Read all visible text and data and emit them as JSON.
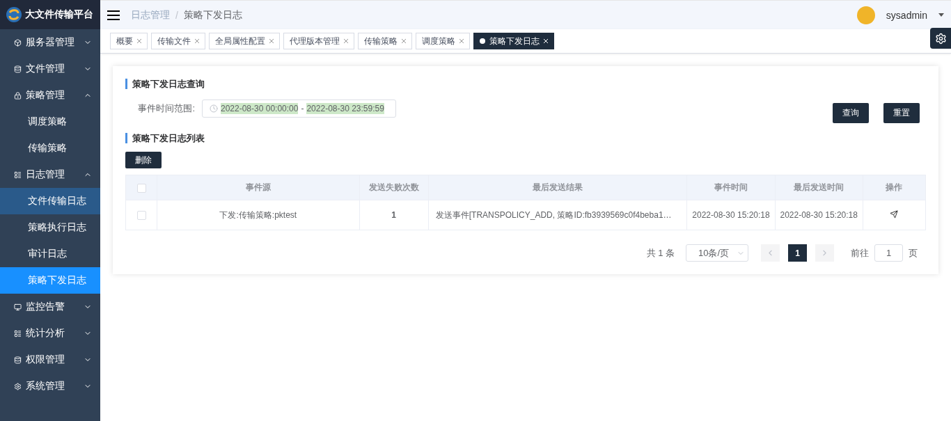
{
  "brand": {
    "title": "大文件传输平台"
  },
  "sidebar": {
    "items": [
      {
        "label": "服务器管理",
        "expanded": false
      },
      {
        "label": "文件管理",
        "expanded": false
      },
      {
        "label": "策略管理",
        "expanded": true,
        "children": [
          {
            "label": "调度策略",
            "selected": false,
            "hovered": false
          },
          {
            "label": "传输策略",
            "selected": false,
            "hovered": false
          }
        ]
      },
      {
        "label": "日志管理",
        "expanded": true,
        "children": [
          {
            "label": "文件传输日志",
            "selected": false,
            "hovered": true
          },
          {
            "label": "策略执行日志",
            "selected": false,
            "hovered": false
          },
          {
            "label": "审计日志",
            "selected": false,
            "hovered": false
          },
          {
            "label": "策略下发日志",
            "selected": true,
            "hovered": false
          }
        ]
      },
      {
        "label": "监控告警",
        "expanded": false
      },
      {
        "label": "统计分析",
        "expanded": false
      },
      {
        "label": "权限管理",
        "expanded": false
      },
      {
        "label": "系统管理",
        "expanded": false
      }
    ]
  },
  "breadcrumb": {
    "items": [
      "日志管理",
      "策略下发日志"
    ],
    "separator": "/"
  },
  "user": {
    "name": "sysadmin"
  },
  "tabs": [
    {
      "label": "概要",
      "selected": false
    },
    {
      "label": "传输文件",
      "selected": false
    },
    {
      "label": "全局属性配置",
      "selected": false
    },
    {
      "label": "代理版本管理",
      "selected": false
    },
    {
      "label": "传输策略",
      "selected": false
    },
    {
      "label": "调度策略",
      "selected": false
    },
    {
      "label": "策略下发日志",
      "selected": true
    }
  ],
  "query": {
    "title": "策略下发日志查询",
    "field_label": "事件时间范围:",
    "start": "2022-08-30 00:00:00",
    "separator": "-",
    "end": "2022-08-30 23:59:59",
    "buttons": [
      "查询",
      "重置"
    ]
  },
  "list": {
    "title": "策略下发日志列表",
    "delete_button": "删除",
    "table": {
      "columns": [
        "事件源",
        "发送失败次数",
        "最后发送结果",
        "事件时间",
        "最后发送时间",
        "操作"
      ],
      "header_checked": false,
      "rows": [
        {
          "checked": false,
          "cells": [
            "下发:传输策略:pktest",
            "1",
            "发送事件[TRANSPOLICY_ADD, 策略ID:fb3939569c0f4beba1…",
            "2022-08-30 15:20:18",
            "2022-08-30 15:20:18"
          ]
        }
      ]
    }
  },
  "pagination": {
    "total": "共 1 条",
    "page_size": "10条/页",
    "pages": [
      {
        "label": "1",
        "selected": true
      }
    ],
    "goto_label": "前往",
    "goto_value": "1",
    "goto_suffix": "页"
  }
}
